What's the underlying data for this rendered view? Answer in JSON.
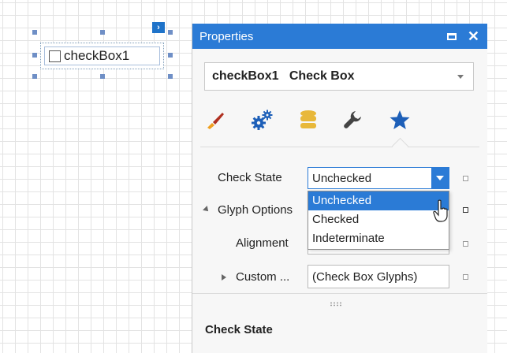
{
  "designer": {
    "control_label": "checkBox1",
    "smart_tag_glyph": "›"
  },
  "panel": {
    "title": "Properties",
    "selector": "checkBox1   Check Box",
    "tabs": [
      {
        "name": "appearance-tab",
        "icon": "paint-brush-icon"
      },
      {
        "name": "behavior-tab",
        "icon": "gears-icon"
      },
      {
        "name": "data-tab",
        "icon": "database-icon"
      },
      {
        "name": "layout-tab",
        "icon": "wrench-icon"
      },
      {
        "name": "favorites-tab",
        "icon": "star-icon",
        "selected": true
      }
    ],
    "properties": {
      "check_state": {
        "label": "Check State",
        "value": "Unchecked"
      },
      "glyph_options": {
        "label": "Glyph Options"
      },
      "alignment": {
        "label": "Alignment"
      },
      "custom": {
        "label": "Custom ...",
        "value": "(Check Box Glyphs)"
      }
    },
    "dropdown_options": [
      "Unchecked",
      "Checked",
      "Indeterminate"
    ],
    "dropdown_selected": "Unchecked",
    "description_title": "Check State"
  },
  "colors": {
    "accent": "#2b7bd6",
    "brush_handle": "#f0a020",
    "brush_tip": "#b03020",
    "icon_blue": "#1d5fb8",
    "database": "#e8b83a",
    "wrench": "#444444"
  }
}
